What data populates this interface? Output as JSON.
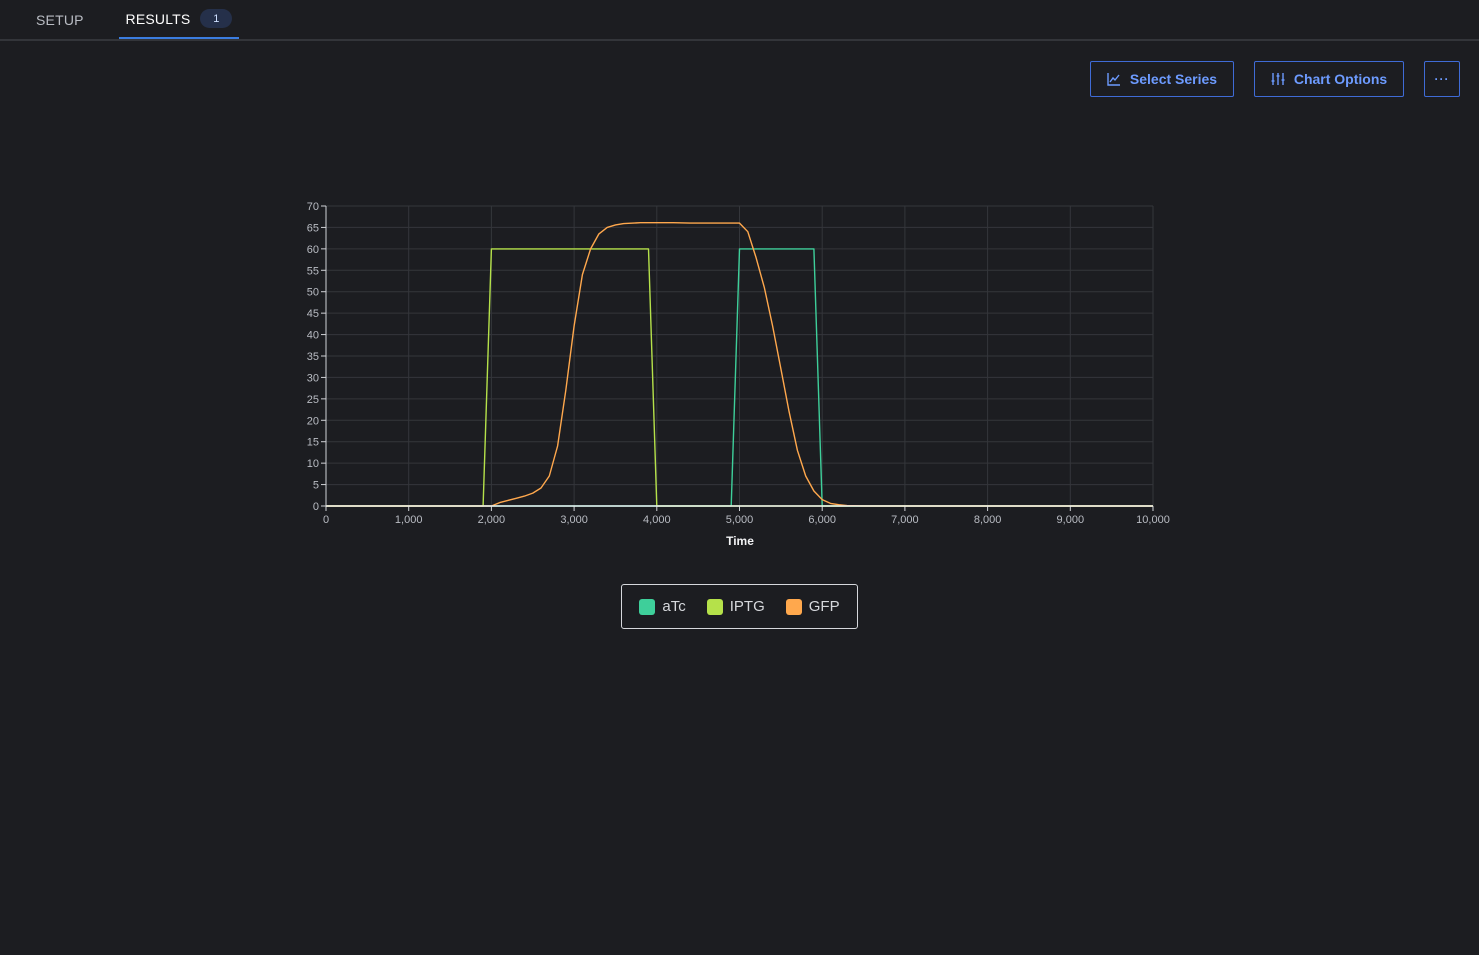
{
  "tabs": [
    {
      "label": "SETUP"
    },
    {
      "label": "RESULTS",
      "badge": "1"
    }
  ],
  "toolbar": {
    "select_series": "Select Series",
    "chart_options": "Chart Options",
    "more": "···"
  },
  "colors": {
    "accent": "#3b7de0",
    "aTc": "#3ecf9a",
    "IPTG": "#b5e14a",
    "GFP": "#ffa84d"
  },
  "chart_data": {
    "type": "line",
    "xlabel": "Time",
    "ylabel": "",
    "xlim": [
      0,
      10000
    ],
    "ylim": [
      0,
      70
    ],
    "x_ticks": [
      "0",
      "1,000",
      "2,000",
      "3,000",
      "4,000",
      "5,000",
      "6,000",
      "7,000",
      "8,000",
      "9,000",
      "10,000"
    ],
    "y_ticks": [
      "0",
      "5",
      "10",
      "15",
      "20",
      "25",
      "30",
      "35",
      "40",
      "45",
      "50",
      "55",
      "60",
      "65",
      "70"
    ],
    "grid": true,
    "legend_position": "bottom-center",
    "series": [
      {
        "name": "aTc",
        "color": "#3ecf9a",
        "x": [
          0,
          4900,
          5000,
          5900,
          6000,
          10000
        ],
        "y": [
          0,
          0,
          60,
          60,
          0,
          0
        ]
      },
      {
        "name": "IPTG",
        "color": "#b5e14a",
        "x": [
          0,
          1900,
          2000,
          3900,
          4000,
          10000
        ],
        "y": [
          0,
          0,
          60,
          60,
          0,
          0
        ]
      },
      {
        "name": "GFP",
        "color": "#ffa84d",
        "x": [
          0,
          2000,
          2100,
          2200,
          2300,
          2400,
          2500,
          2600,
          2700,
          2800,
          2900,
          3000,
          3100,
          3200,
          3300,
          3400,
          3500,
          3600,
          3800,
          4000,
          4200,
          4400,
          4600,
          4800,
          5000,
          5100,
          5200,
          5300,
          5400,
          5500,
          5600,
          5700,
          5800,
          5900,
          6000,
          6100,
          6200,
          6300,
          6500,
          7000,
          10000
        ],
        "y": [
          0,
          0,
          0.8,
          1.3,
          1.8,
          2.3,
          3.0,
          4.2,
          7.0,
          14,
          27,
          42,
          54,
          60,
          63.5,
          65,
          65.6,
          65.9,
          66.1,
          66.1,
          66.1,
          66.0,
          66.0,
          66.0,
          66.0,
          64,
          58,
          51,
          42,
          32,
          22,
          13,
          7,
          3.5,
          1.5,
          0.6,
          0.3,
          0.1,
          0,
          0,
          0
        ]
      }
    ]
  },
  "legend": [
    {
      "label": "aTc"
    },
    {
      "label": "IPTG"
    },
    {
      "label": "GFP"
    }
  ]
}
